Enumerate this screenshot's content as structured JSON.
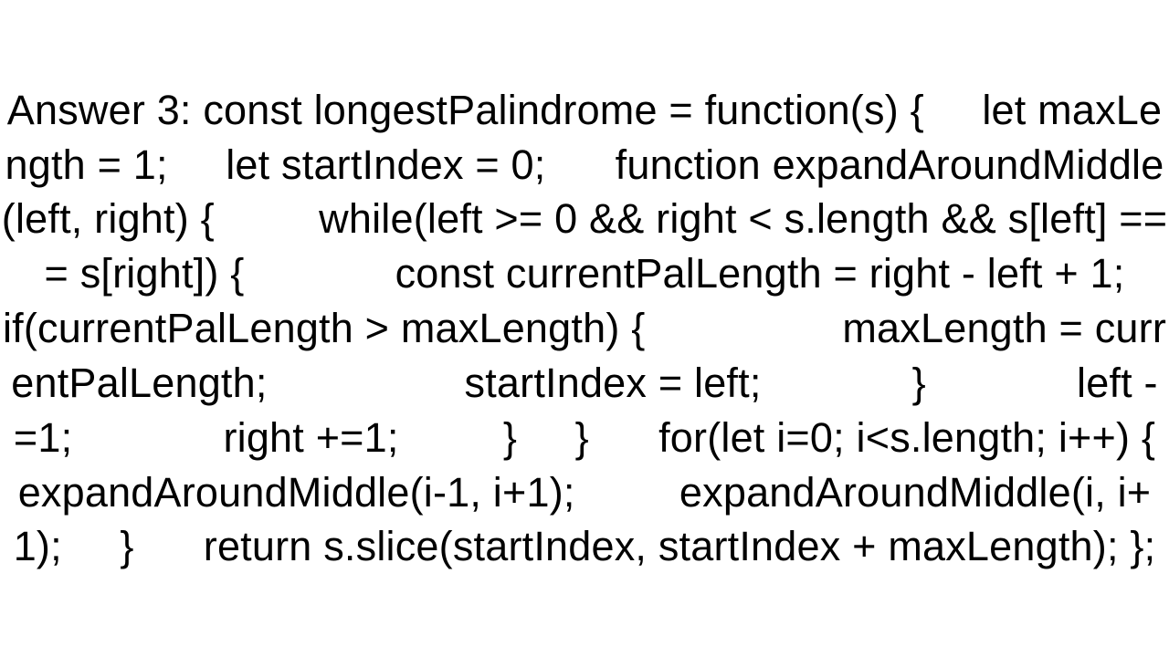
{
  "answer_label": "Answer 3:",
  "code_text": "Answer 3: const longestPalindrome = function(s) {     let maxLength = 1;     let startIndex = 0;      function expandAroundMiddle(left, right) {         while(left >= 0 && right < s.length && s[left] === s[right]) {             const currentPalLength = right - left + 1;             if(currentPalLength > maxLength) {                 maxLength = currentPalLength;                 startIndex = left;             }             left -=1;             right +=1;         }     }      for(let i=0; i<s.length; i++) {         expandAroundMiddle(i-1, i+1);         expandAroundMiddle(i, i+1);     }      return s.slice(startIndex, startIndex + maxLength); };",
  "code_structured": {
    "language": "javascript",
    "function_name": "longestPalindrome",
    "parameters": [
      "s"
    ],
    "variables": [
      {
        "name": "maxLength",
        "initial": 1
      },
      {
        "name": "startIndex",
        "initial": 0
      }
    ],
    "inner_function": {
      "name": "expandAroundMiddle",
      "parameters": [
        "left",
        "right"
      ],
      "loop_condition": "left >= 0 && right < s.length && s[left] === s[right]",
      "body": [
        "const currentPalLength = right - left + 1;",
        "if(currentPalLength > maxLength) { maxLength = currentPalLength; startIndex = left; }",
        "left -=1;",
        "right +=1;"
      ]
    },
    "main_loop": {
      "init": "let i=0",
      "condition": "i<s.length",
      "increment": "i++",
      "body": [
        "expandAroundMiddle(i-1, i+1);",
        "expandAroundMiddle(i, i+1);"
      ]
    },
    "return": "s.slice(startIndex, startIndex + maxLength)"
  }
}
